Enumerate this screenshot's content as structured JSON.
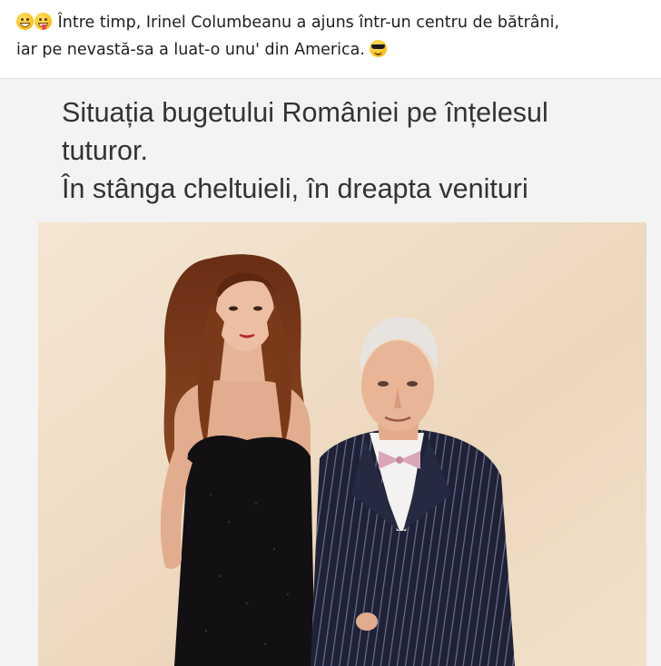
{
  "post": {
    "emojis_leading": [
      "grinning-face-icon",
      "zany-face-icon"
    ],
    "text_line_1": "Între timp, Irinel Columbeanu a ajuns într-un centru de bătrâni,",
    "text_line_2": "iar pe nevastă-sa a luat-o unu' din America.",
    "emoji_trailing": "sunglasses-face-icon"
  },
  "meme": {
    "caption_lines": [
      "Situația bugetului României pe înțelesul",
      "tuturor.",
      "În stânga cheltuieli, în dreapta venituri"
    ]
  },
  "colors": {
    "text": "#1c1e21",
    "caption": "#333333",
    "photo_background": "#efdcc4",
    "divider": "#dadde1"
  }
}
